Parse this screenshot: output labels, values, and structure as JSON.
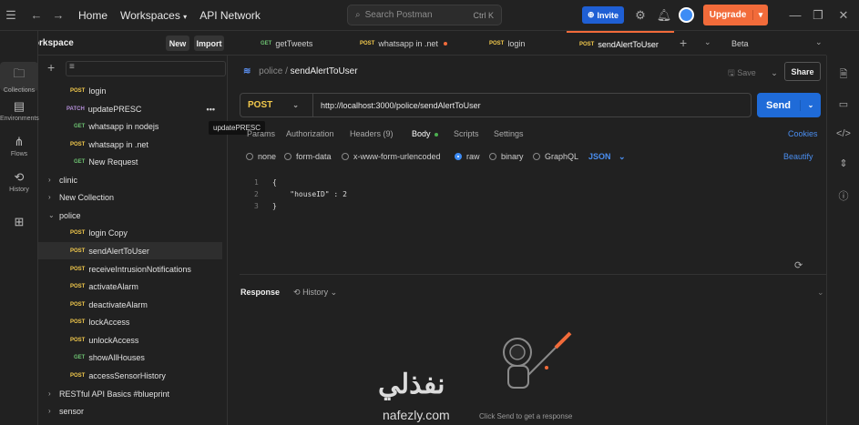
{
  "topbar": {
    "home": "Home",
    "workspaces": "Workspaces",
    "api_network": "API Network",
    "search_placeholder": "Search Postman",
    "search_shortcut": "Ctrl K",
    "invite": "Invite",
    "upgrade": "Upgrade"
  },
  "workspace": {
    "title": "My Workspace",
    "new_label": "New",
    "import_label": "Import"
  },
  "rail": {
    "items": [
      {
        "label": "Collections",
        "icon": "collections-icon"
      },
      {
        "label": "Environments",
        "icon": "environments-icon"
      },
      {
        "label": "Flows",
        "icon": "flows-icon"
      },
      {
        "label": "History",
        "icon": "history-icon"
      }
    ]
  },
  "sidebar": {
    "tooltip": "updatePRESC",
    "rows": [
      {
        "method": "POST",
        "label": "login"
      },
      {
        "method": "PATCH",
        "label": "updatePRESC"
      },
      {
        "method": "GET",
        "label": "whatsapp in nodejs"
      },
      {
        "method": "POST",
        "label": "whatsapp in .net"
      },
      {
        "method": "GET",
        "label": "New Request"
      },
      {
        "folder": true,
        "label": "clinic"
      },
      {
        "folder": true,
        "label": "New Collection"
      },
      {
        "folder": true,
        "label": "police",
        "open": true
      },
      {
        "method": "POST",
        "label": "login Copy"
      },
      {
        "method": "POST",
        "label": "sendAlertToUser"
      },
      {
        "method": "POST",
        "label": "receiveIntrusionNotifications"
      },
      {
        "method": "POST",
        "label": "activateAlarm"
      },
      {
        "method": "POST",
        "label": "deactivateAlarm"
      },
      {
        "method": "POST",
        "label": "lockAccess"
      },
      {
        "method": "POST",
        "label": "unlockAccess"
      },
      {
        "method": "GET",
        "label": "showAllHouses"
      },
      {
        "method": "POST",
        "label": "accessSensorHistory"
      },
      {
        "folder": true,
        "label": "RESTful API Basics #blueprint"
      },
      {
        "folder": true,
        "label": "sensor"
      }
    ]
  },
  "tabs": [
    {
      "method": "GET",
      "label": "getTweets"
    },
    {
      "method": "POST",
      "label": "whatsapp in .net"
    },
    {
      "method": "POST",
      "label": "login"
    },
    {
      "method": "POST",
      "label": "sendAlertToUser"
    }
  ],
  "env": "Beta",
  "request": {
    "breadcrumb_parent": "police",
    "breadcrumb_current": "sendAlertToUser",
    "save": "Save",
    "share": "Share",
    "method": "POST",
    "url": "http://localhost:3000/police/sendAlertToUser",
    "send": "Send",
    "tabs": [
      "Params",
      "Authorization",
      "Headers (9)",
      "Body",
      "Scripts",
      "Settings"
    ],
    "cookies": "Cookies",
    "body_types": [
      "none",
      "form-data",
      "x-www-form-urlencoded",
      "raw",
      "binary",
      "GraphQL"
    ],
    "format": "JSON",
    "beautify": "Beautify",
    "code_lines": [
      "{",
      "    \"houseID\" : 2",
      "}"
    ]
  },
  "response": {
    "label": "Response",
    "history": "History",
    "hint": "Click Send to get a response"
  },
  "watermark": {
    "arabic": "نفذلي",
    "latin": "nafezly.com"
  },
  "colors": {
    "accent": "#f26b3a",
    "primary": "#1f6bd8",
    "post": "#f2c94c",
    "get": "#6cc070",
    "patch": "#b48ed8"
  }
}
